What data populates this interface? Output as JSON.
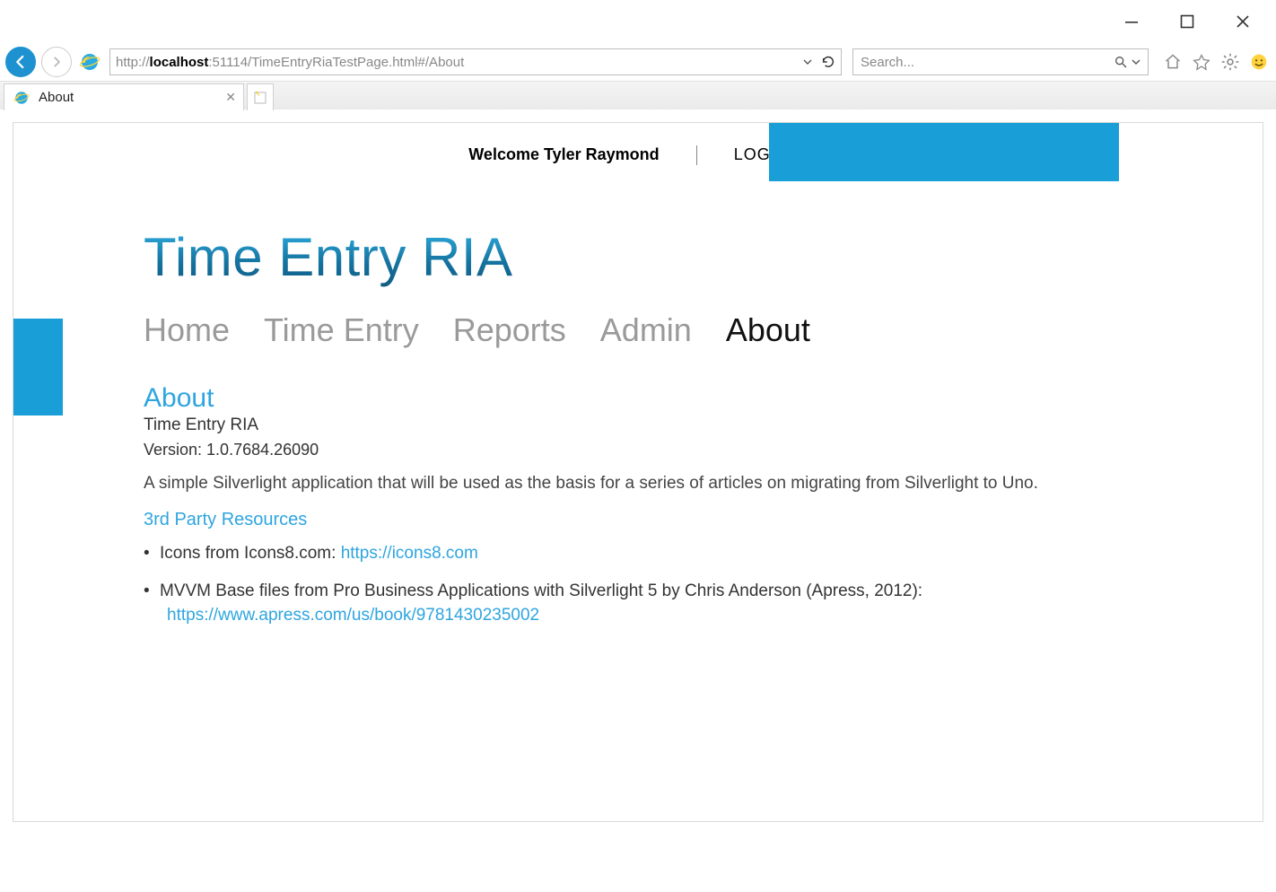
{
  "browser": {
    "url_protocol": "http://",
    "url_host": "localhost",
    "url_rest": ":51114/TimeEntryRiaTestPage.html#/About",
    "search_placeholder": "Search...",
    "tab_title": "About"
  },
  "app": {
    "welcome_text": "Welcome Tyler Raymond",
    "logout_label": "LOGOUT",
    "title": "Time Entry RIA",
    "nav": {
      "home": "Home",
      "time_entry": "Time Entry",
      "reports": "Reports",
      "admin": "Admin",
      "about": "About"
    },
    "about": {
      "heading": "About",
      "subtitle": "Time Entry RIA",
      "version_label": "Version: 1.0.7684.26090",
      "description": "A simple Silverlight application that will be used as the basis for a series of articles on migrating from Silverlight to Uno.",
      "resources_heading": "3rd Party Resources",
      "res1_text": "Icons from Icons8.com:  ",
      "res1_link": "https://icons8.com",
      "res2_text": "MVVM Base files from Pro Business Applications with Silverlight 5 by Chris Anderson (Apress, 2012):",
      "res2_link": "https://www.apress.com/us/book/9781430235002"
    }
  }
}
